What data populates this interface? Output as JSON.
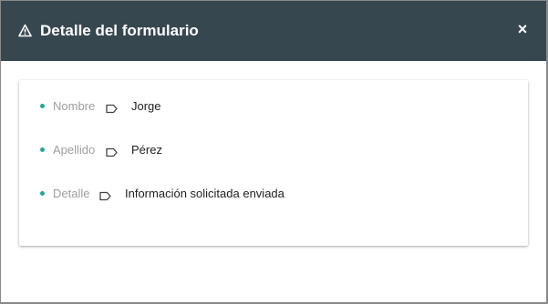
{
  "modal": {
    "title": "Detalle del formulario",
    "close_label": "×",
    "header_icon": "warning-icon",
    "header_color": "#37474f",
    "accent_color": "#26a69a"
  },
  "fields": [
    {
      "label": "Nombre",
      "value": "Jorge",
      "icon": "tag-icon"
    },
    {
      "label": "Apellido",
      "value": "Pérez",
      "icon": "tag-icon"
    },
    {
      "label": "Detalle",
      "value": "Información solicitada enviada",
      "icon": "tag-icon"
    }
  ]
}
